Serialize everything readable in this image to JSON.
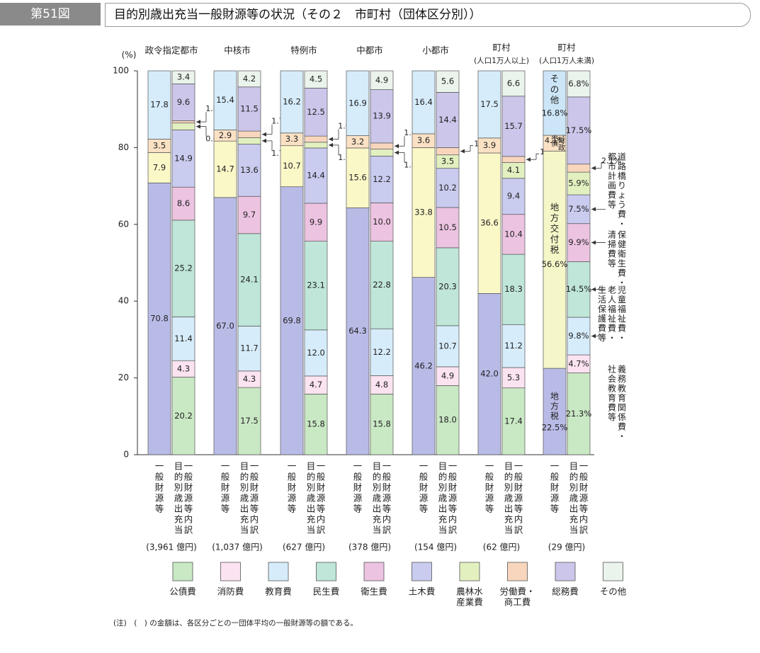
{
  "header": {
    "figure_number": "第51図",
    "title": "目的別歳出充当一般財源等の状況（その２　市町村（団体区分別））"
  },
  "note": "(注)　(　) の金額は、各区分ごとの一団体平均の一般財源等の額である。",
  "colors": {
    "公債費": "#c9e8c4",
    "消防費": "#fbe3f1",
    "教育費": "#d6ecfb",
    "民生費": "#bfe6d8",
    "衛生費": "#ecc3e1",
    "土木費": "#c9cbef",
    "農林水産業費": "#e2f0c0",
    "労働費・商工費": "#f8d6bd",
    "総務費": "#cbc6ea",
    "その他": "#eaf4ec",
    "地方税": "#b9bbe7",
    "地方交付税": "#f6f7c8",
    "対策債臨時財政": "#fbe2c4",
    "その他財源": "#cce6f8",
    "left_default_b": "#fbf8c8",
    "left_default_c": "#fbe1c4",
    "left_default_d": "#d6ecfb"
  },
  "chart_data": {
    "type": "bar",
    "ylabel": "(%)",
    "ylim": [
      0,
      100
    ],
    "yticks": [
      0,
      20,
      40,
      60,
      80,
      100
    ],
    "bar_label_general": "一般財源等",
    "bar_label_purpose": "目的別歳出充当内訳",
    "categories": [
      {
        "name": "政令指定都市",
        "sub": "",
        "amount": "(3,961 億円)",
        "general": [
          70.8,
          7.9,
          3.5,
          17.8
        ],
        "general_labels": [
          "70.8",
          "7.9",
          "3.5",
          "17.8"
        ],
        "purpose": [
          20.2,
          4.3,
          11.4,
          25.2,
          8.6,
          14.9,
          1.8,
          0.6,
          9.6,
          3.4
        ],
        "purpose_labels": [
          "20.2",
          "4.3",
          "11.4",
          "25.2",
          "8.6",
          "14.9",
          "",
          "",
          "9.6",
          "3.4"
        ],
        "callouts": [
          "1.8",
          "0.6"
        ]
      },
      {
        "name": "中核市",
        "sub": "",
        "amount": "(1,037 億円)",
        "general": [
          67.0,
          14.7,
          2.9,
          15.4
        ],
        "general_labels": [
          "67.0",
          "14.7",
          "2.9",
          "15.4"
        ],
        "purpose": [
          17.5,
          4.3,
          11.7,
          24.1,
          9.7,
          13.6,
          1.7,
          1.7,
          11.5,
          4.2
        ],
        "purpose_labels": [
          "17.5",
          "4.3",
          "11.7",
          "24.1",
          "9.7",
          "13.6",
          "",
          "",
          "11.5",
          "4.2"
        ],
        "callouts": [
          "1.7",
          "1.7"
        ]
      },
      {
        "name": "特例市",
        "sub": "",
        "amount": "(627 億円)",
        "general": [
          69.8,
          10.7,
          3.3,
          16.2
        ],
        "general_labels": [
          "69.8",
          "10.7",
          "3.3",
          "16.2"
        ],
        "purpose": [
          15.8,
          4.7,
          12.0,
          23.1,
          9.9,
          14.4,
          1.5,
          1.6,
          12.5,
          4.5
        ],
        "purpose_labels": [
          "15.8",
          "4.7",
          "12.0",
          "23.1",
          "9.9",
          "14.4",
          "",
          "",
          "12.5",
          "4.5"
        ],
        "callouts": [
          "1.6",
          "1.5"
        ]
      },
      {
        "name": "中都市",
        "sub": "",
        "amount": "(378 億円)",
        "general": [
          64.3,
          15.6,
          3.2,
          16.9
        ],
        "general_labels": [
          "64.3",
          "15.6",
          "3.2",
          "16.9"
        ],
        "purpose": [
          15.8,
          4.8,
          12.2,
          22.8,
          10.0,
          12.2,
          1.8,
          1.6,
          13.9,
          4.9
        ],
        "purpose_labels": [
          "15.8",
          "4.8",
          "12.2",
          "22.8",
          "10.0",
          "12.2",
          "",
          "",
          "13.9",
          "4.9"
        ],
        "callouts": [
          "1.6",
          "1.8"
        ]
      },
      {
        "name": "小都市",
        "sub": "",
        "amount": "(154 億円)",
        "general": [
          46.2,
          33.8,
          3.6,
          16.4
        ],
        "general_labels": [
          "46.2",
          "33.8",
          "3.6",
          "16.4"
        ],
        "purpose": [
          18.0,
          4.9,
          10.7,
          20.3,
          10.5,
          10.2,
          3.5,
          1.9,
          14.4,
          5.6
        ],
        "purpose_labels": [
          "18.0",
          "4.9",
          "10.7",
          "20.3",
          "10.5",
          "10.2",
          "3.5",
          "",
          "14.4",
          "5.6"
        ],
        "callouts": [
          "1.9"
        ]
      },
      {
        "name": "町村",
        "sub": "(人口1万人以上)",
        "amount": "(62 億円)",
        "general": [
          42.0,
          36.6,
          3.9,
          17.5
        ],
        "general_labels": [
          "42.0",
          "36.6",
          "3.9",
          "17.5"
        ],
        "purpose": [
          17.4,
          5.3,
          11.2,
          18.3,
          10.4,
          9.4,
          4.1,
          1.6,
          15.7,
          6.6
        ],
        "purpose_labels": [
          "17.4",
          "5.3",
          "11.2",
          "18.3",
          "10.4",
          "9.4",
          "4.1",
          "",
          "15.7",
          "6.6"
        ],
        "callouts": [
          "1.6"
        ]
      },
      {
        "name": "町村",
        "sub": "(人口1万人未満)",
        "amount": "(29 億円)",
        "general": [
          22.5,
          56.6,
          4.1,
          16.8
        ],
        "general_labels": [
          "地方税\n22.5%",
          "地方交付税\n56.6%",
          "臨時財政\n対策債\n4.1%",
          "その他\n16.8%"
        ],
        "purpose": [
          21.3,
          4.7,
          9.8,
          14.5,
          9.9,
          7.5,
          5.9,
          2.1,
          17.5,
          6.8
        ],
        "purpose_labels": [
          "21.3%",
          "4.7%",
          "9.8%",
          "14.5%",
          "9.9%",
          "7.5%",
          "5.9%",
          "",
          "17.5%",
          "6.8%"
        ],
        "callouts": [
          "2.1%"
        ]
      }
    ],
    "legend": [
      "公債費",
      "消防費",
      "教育費",
      "民生費",
      "衛生費",
      "土木費",
      "農林水産業費",
      "労働費・商工費",
      "総務費",
      "その他"
    ],
    "legend_display": [
      "公債費",
      "消防費",
      "教育費",
      "民生費",
      "衛生費",
      "土木費",
      "農林水\n産業費",
      "労働費・\n商工費",
      "総務費",
      "その他"
    ],
    "right_annotations": [
      "道路橋りょう費・\n都市計画費等",
      "保健衛生費・\n清掃費等",
      "児童福祉費・\n老人福祉費・\n生活保護費等",
      "義務教育関係費・\n社会教育費等"
    ]
  }
}
